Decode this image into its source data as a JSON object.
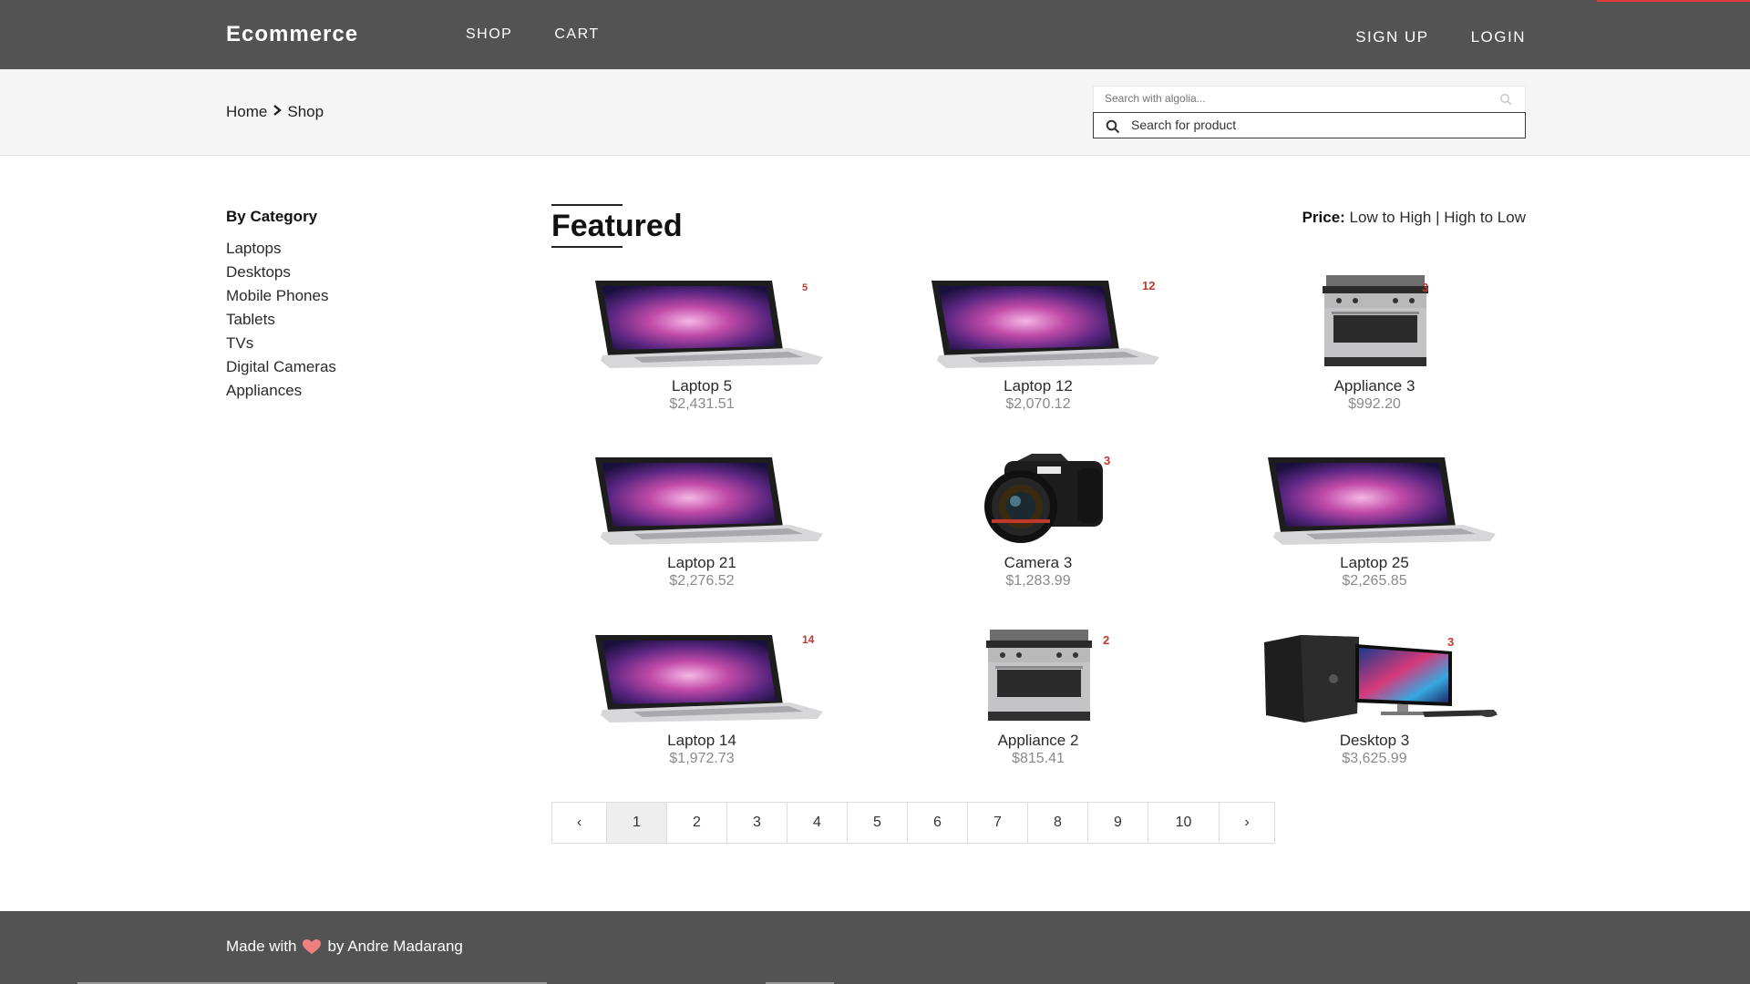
{
  "header": {
    "brand": "Ecommerce",
    "nav_left": [
      "SHOP",
      "CART"
    ],
    "nav_right": [
      "SIGN UP",
      "LOGIN"
    ],
    "accent_color": "#e03a3a"
  },
  "breadcrumb": {
    "home": "Home",
    "current": "Shop"
  },
  "search": {
    "algolia_placeholder": "Search with algolia...",
    "product_placeholder": "Search for product"
  },
  "sidebar": {
    "title": "By Category",
    "categories": [
      "Laptops",
      "Desktops",
      "Mobile Phones",
      "Tablets",
      "TVs",
      "Digital Cameras",
      "Appliances"
    ]
  },
  "main": {
    "title": "Featured",
    "sort": {
      "label": "Price:",
      "low_high": "Low to High",
      "separator": "|",
      "high_low": "High to Low"
    },
    "products": [
      {
        "name": "Laptop 5",
        "price": "$2,431.51",
        "badge": "5",
        "image": "laptop-icon"
      },
      {
        "name": "Laptop 12",
        "price": "$2,070.12",
        "badge": "12",
        "image": "laptop-icon"
      },
      {
        "name": "Appliance 3",
        "price": "$992.20",
        "badge": "3",
        "image": "stove-icon"
      },
      {
        "name": "Laptop 21",
        "price": "$2,276.52",
        "badge": "",
        "image": "laptop-icon"
      },
      {
        "name": "Camera 3",
        "price": "$1,283.99",
        "badge": "3",
        "image": "camera-icon"
      },
      {
        "name": "Laptop 25",
        "price": "$2,265.85",
        "badge": "",
        "image": "laptop-icon"
      },
      {
        "name": "Laptop 14",
        "price": "$1,972.73",
        "badge": "14",
        "image": "laptop-icon"
      },
      {
        "name": "Appliance 2",
        "price": "$815.41",
        "badge": "2",
        "image": "stove-icon"
      },
      {
        "name": "Desktop 3",
        "price": "$3,625.99",
        "badge": "3",
        "image": "desktop-icon"
      }
    ]
  },
  "pagination": {
    "prev": "‹",
    "pages": [
      "1",
      "2",
      "3",
      "4",
      "5",
      "6",
      "7",
      "8",
      "9",
      "10"
    ],
    "next": "›",
    "current": "1"
  },
  "footer": {
    "made_with": "Made with",
    "by": "by Andre Madarang",
    "heart_color": "#f08080"
  }
}
